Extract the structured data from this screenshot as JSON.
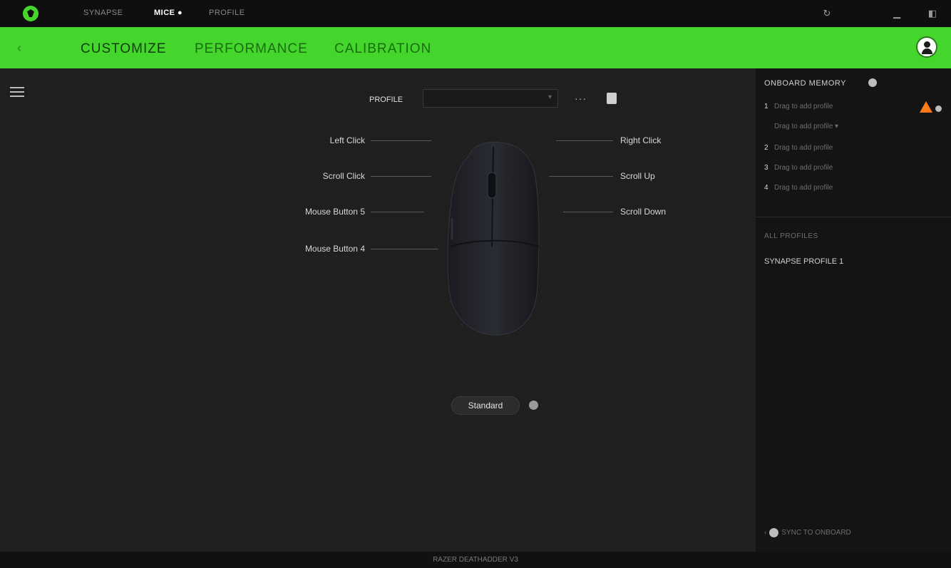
{
  "topbar": {
    "tabs": [
      {
        "label": "SYNAPSE",
        "active": false
      },
      {
        "label": "MICE ●",
        "active": true
      },
      {
        "label": "PROFILE",
        "active": false
      }
    ],
    "icons": [
      "refresh-icon",
      "minimize-icon",
      "maximize-icon"
    ]
  },
  "subnav": {
    "tabs": [
      {
        "label": "CUSTOMIZE",
        "active": true
      },
      {
        "label": "PERFORMANCE",
        "active": false
      },
      {
        "label": "CALIBRATION",
        "active": false
      }
    ]
  },
  "profile": {
    "label": "PROFILE",
    "value": "",
    "more": "···"
  },
  "mouse_buttons": {
    "left": [
      "Left Click",
      "Scroll Click",
      "Mouse Button 5",
      "Mouse Button 4"
    ],
    "right": [
      "Right Click",
      "Scroll Up",
      "Scroll Down"
    ]
  },
  "standard_button": "Standard",
  "right_panel": {
    "title": "ONBOARD MEMORY",
    "slots": [
      {
        "num": "1",
        "label": "Drag to add profile"
      },
      {
        "num": "",
        "label": "Drag to add profile ▾"
      },
      {
        "num": "2",
        "label": "Drag to add profile"
      },
      {
        "num": "3",
        "label": "Drag to add profile"
      },
      {
        "num": "4",
        "label": "Drag to add profile"
      }
    ],
    "section_title": "ALL PROFILES",
    "profiles": [
      "SYNAPSE PROFILE 1"
    ],
    "footer": "SYNC TO ONBOARD"
  },
  "statusbar": {
    "text": "RAZER DEATHADDER V3"
  }
}
